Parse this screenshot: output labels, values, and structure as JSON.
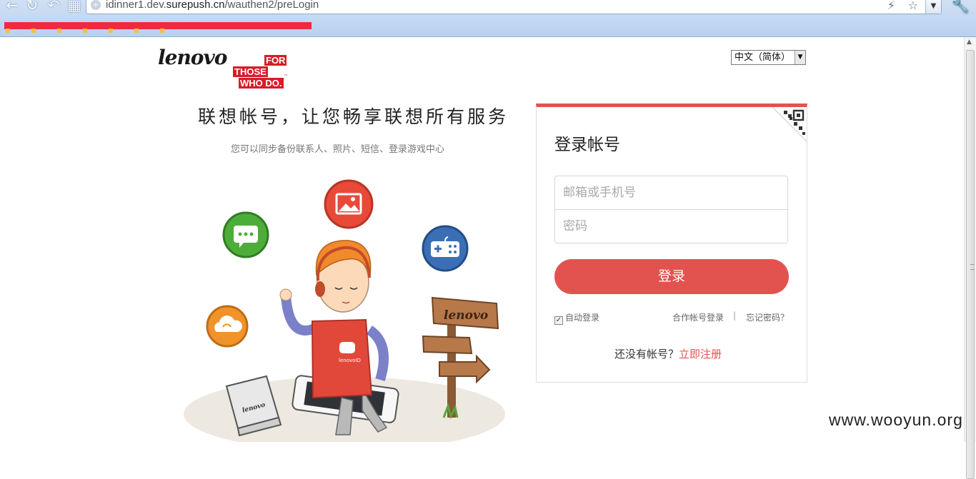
{
  "browser": {
    "url_prefix": "idinner1.dev.",
    "url_domain": "surepush.cn",
    "url_path": "/wauthen2/preLogin"
  },
  "logo": {
    "brand": "lenovo",
    "tag_line1": "FOR",
    "tag_line2": "THOSE",
    "tag_line3": "WHO DO.",
    "tm": "™"
  },
  "language": {
    "selected": "中文（简体）"
  },
  "hero": {
    "slogan": "联想帐号，让您畅享联想所有服务",
    "subtitle": "您可以同步备份联系人、照片、短信、登录游戏中心"
  },
  "illustration": {
    "shirt_text": "lenovoID",
    "sign_text": "lenovo",
    "laptop_text": "lenovo"
  },
  "login": {
    "title": "登录帐号",
    "account_placeholder": "邮箱或手机号",
    "password_placeholder": "密码",
    "submit": "登录",
    "remember_label": "自动登录",
    "remember_checked": true,
    "partner_login": "合作帐号登录",
    "separator": "|",
    "forgot": "忘记密码？",
    "no_account": "还没有帐号？",
    "register": "立即注册"
  },
  "watermark": "www.wooyun.org",
  "colors": {
    "accent": "#e2524f",
    "lenovo_red": "#d71d27"
  }
}
